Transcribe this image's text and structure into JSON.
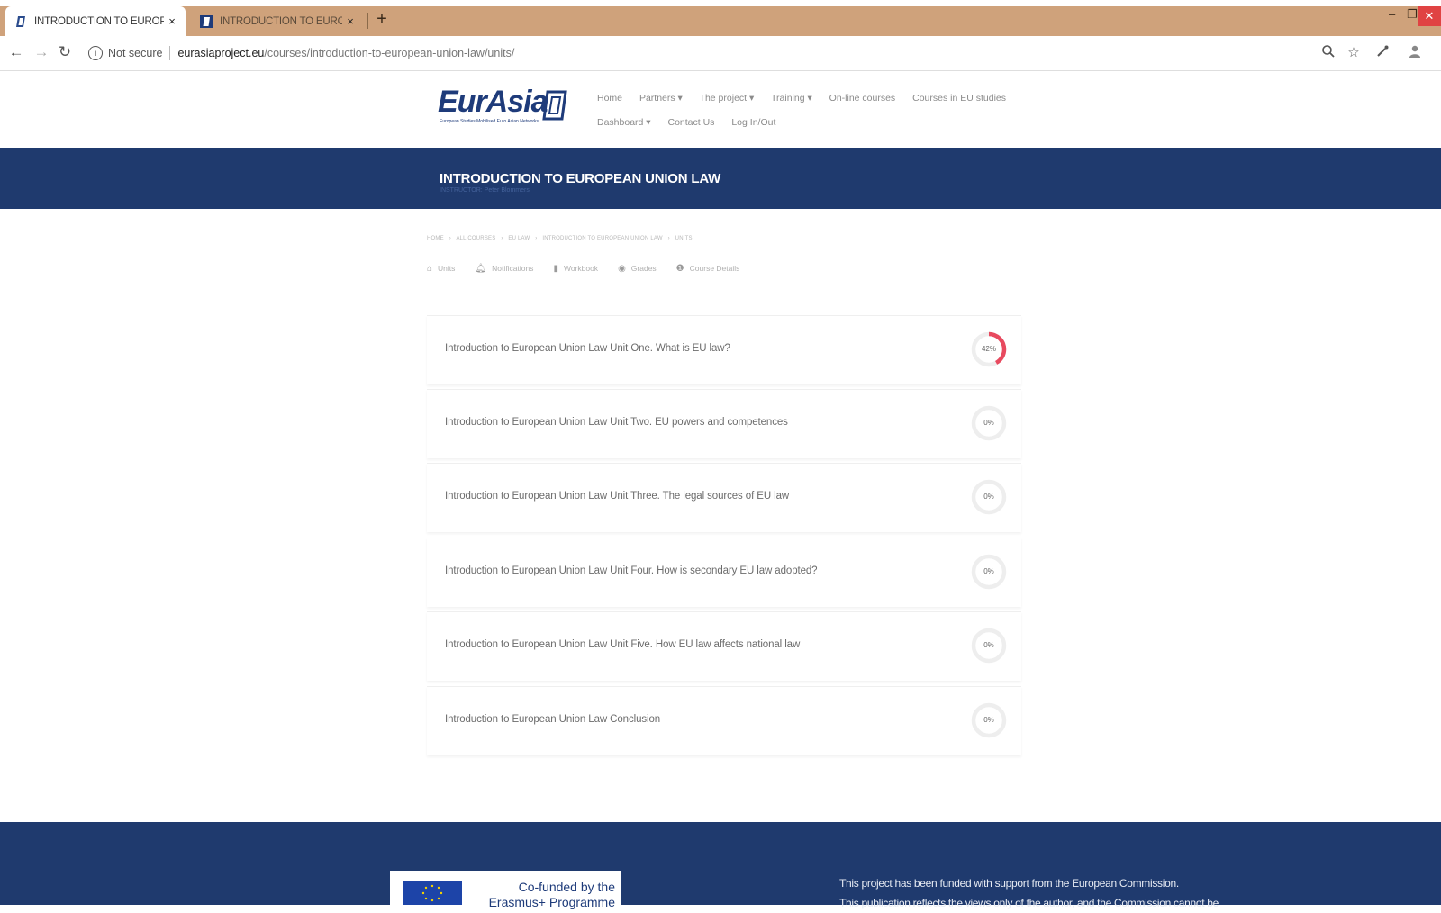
{
  "browser": {
    "tabs": [
      {
        "title": "INTRODUCTION TO EUROPEAN",
        "close": "×"
      },
      {
        "title": "INTRODUCTION TO EUROPEAN",
        "close": "×"
      }
    ],
    "new_tab": "+",
    "address": {
      "not_secure": "Not secure",
      "host": "eurasiaproject.eu",
      "path": "/courses/introduction-to-european-union-law/units/"
    }
  },
  "site": {
    "logo_text": "EurAsia",
    "logo_tagline": "European Studies Mobilised Euro Asian Networks",
    "nav_row1": [
      "Home",
      "Partners ▾",
      "The project ▾",
      "Training ▾",
      "On-line courses",
      "Courses in EU studies"
    ],
    "nav_row2": [
      "Dashboard ▾",
      "Contact Us",
      "Log In/Out"
    ]
  },
  "banner": {
    "title": "INTRODUCTION TO EUROPEAN UNION LAW",
    "subtitle": "INSTRUCTOR: Peter Blommers"
  },
  "breadcrumb": [
    "HOME",
    "›",
    "ALL COURSES",
    "›",
    "EU LAW",
    "›",
    "INTRODUCTION TO EUROPEAN UNION LAW",
    "›",
    "UNITS"
  ],
  "course_tabs": [
    {
      "label": "Units",
      "icon": "home-icon"
    },
    {
      "label": "Notifications",
      "icon": "bell-icon"
    },
    {
      "label": "Workbook",
      "icon": "book-icon"
    },
    {
      "label": "Grades",
      "icon": "grades-icon"
    },
    {
      "label": "Course Details",
      "icon": "info-icon"
    }
  ],
  "units": [
    {
      "title": "Introduction to European Union Law Unit One. What is EU law?",
      "progress": "42%",
      "progress_value": 0.42
    },
    {
      "title": "Introduction to European Union Law Unit Two. EU powers and competences",
      "progress": "0%",
      "progress_value": 0
    },
    {
      "title": "Introduction to European Union Law Unit Three. The legal sources of EU law",
      "progress": "0%",
      "progress_value": 0
    },
    {
      "title": "Introduction to European Union Law Unit Four. How is secondary EU law adopted?",
      "progress": "0%",
      "progress_value": 0
    },
    {
      "title": "Introduction to European Union Law Unit Five. How EU law affects national law",
      "progress": "0%",
      "progress_value": 0
    },
    {
      "title": "Introduction to European Union Law Conclusion",
      "progress": "0%",
      "progress_value": 0
    }
  ],
  "footer": {
    "eu_line1": "Co-funded by the",
    "eu_line2": "Erasmus+ Programme",
    "text_line1": "This project has been funded with support from the European Commission.",
    "text_line2": "This publication reflects the views only of the author, and the Commission cannot be"
  },
  "colors": {
    "tabbar": "#cfa27b",
    "banner": "#1f3a6e",
    "progress": "#e84a5f",
    "ring_track": "#eeeeee"
  }
}
